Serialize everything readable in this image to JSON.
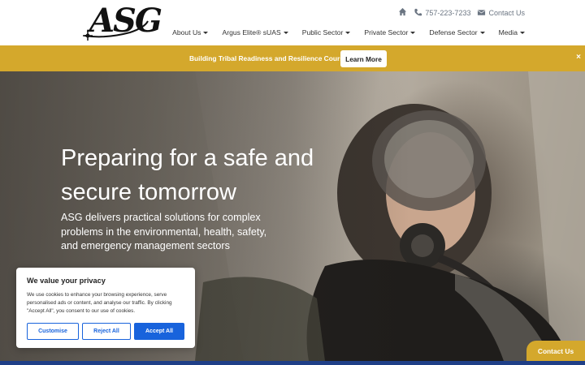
{
  "header": {
    "logo_text": "ASG",
    "phone": "757-223-7233",
    "contact_link": "Contact Us",
    "nav": [
      {
        "label": "About Us",
        "key": "about"
      },
      {
        "label": "Argus Elite® sUAS",
        "key": "argus"
      },
      {
        "label": "Public Sector",
        "key": "public"
      },
      {
        "label": "Private Sector",
        "key": "private"
      },
      {
        "label": "Defense Sector",
        "key": "defense"
      },
      {
        "label": "Media",
        "key": "media"
      }
    ]
  },
  "banner": {
    "text": "Building Tribal Readiness and Resilience Courses",
    "button": "Learn More",
    "close": "×",
    "color": "#d4a82c"
  },
  "hero": {
    "title": "Preparing for a safe and secure tomorrow",
    "subtitle": "ASG delivers practical solutions for complex problems in the environmental, health, safety, and emergency management sectors"
  },
  "cookie": {
    "title": "We value your privacy",
    "body": "We use cookies to enhance your browsing experience, serve personalised ads or content, and analyse our traffic. By clicking \"Accept All\", you consent to our use of cookies.",
    "customise": "Customise",
    "reject": "Reject All",
    "accept": "Accept All",
    "accent": "#1863dc"
  },
  "contact_tab": "Contact Us"
}
